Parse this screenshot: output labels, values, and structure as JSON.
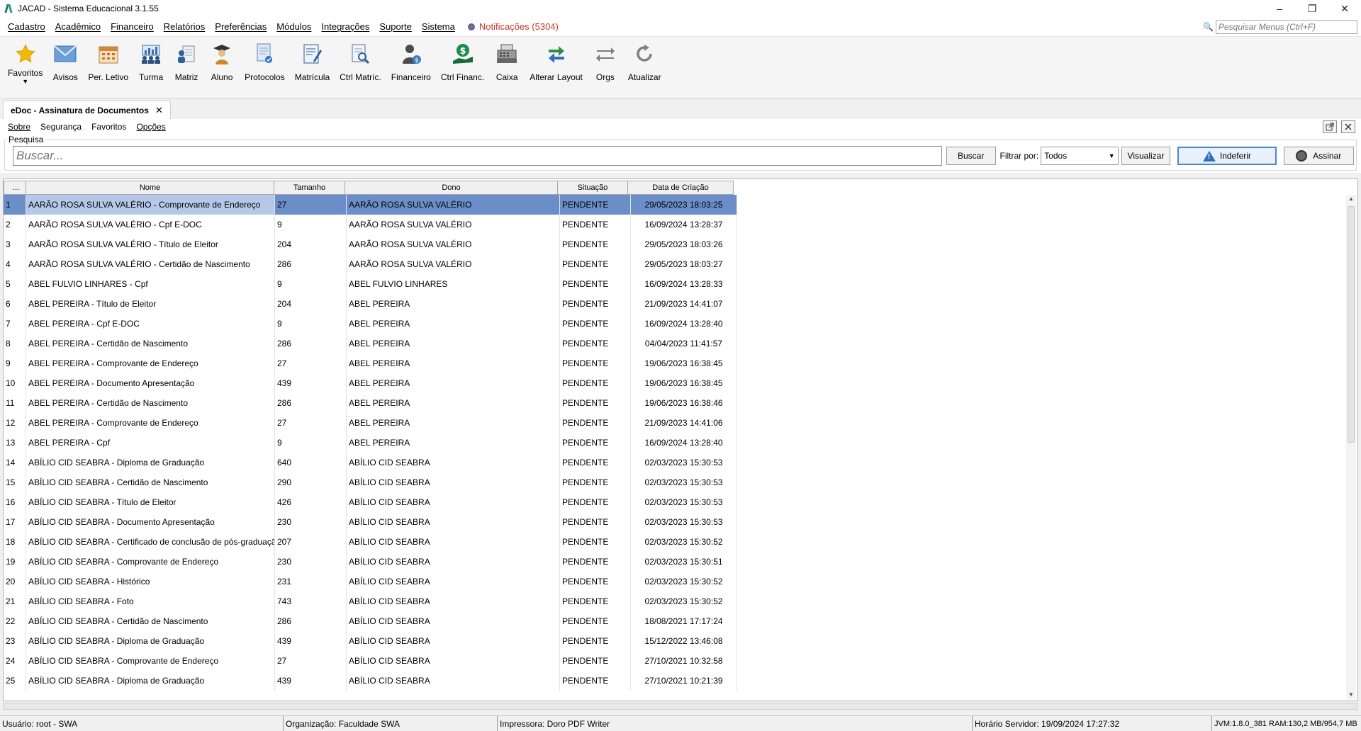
{
  "window": {
    "title": "JACAD - Sistema Educacional 3.1.55",
    "minimize": "–",
    "maximize": "❐",
    "close": "✕"
  },
  "menubar": {
    "items": [
      "Cadastro",
      "Acadêmico",
      "Financeiro",
      "Relatórios",
      "Preferências",
      "Módulos",
      "Integrações",
      "Suporte",
      "Sistema"
    ],
    "notifications": "Notificações (5304)",
    "search_placeholder": "Pesquisar Menus (Ctrl+F)"
  },
  "toolbar": {
    "favorites": "Favoritos",
    "tools": [
      {
        "label": "Avisos",
        "icon": "envelope-icon"
      },
      {
        "label": "Per. Letivo",
        "icon": "calendar-icon"
      },
      {
        "label": "Turma",
        "icon": "group-chart-icon"
      },
      {
        "label": "Matriz",
        "icon": "matrix-person-icon"
      },
      {
        "label": "Aluno",
        "icon": "graduate-icon"
      },
      {
        "label": "Protocolos",
        "icon": "protocol-doc-icon"
      },
      {
        "label": "Matrícula",
        "icon": "enrollment-doc-icon"
      },
      {
        "label": "Ctrl Matríc.",
        "icon": "doc-search-icon"
      },
      {
        "label": "Financeiro",
        "icon": "finance-person-icon"
      },
      {
        "label": "Ctrl Financ.",
        "icon": "money-hand-icon"
      },
      {
        "label": "Caixa",
        "icon": "cash-register-icon"
      },
      {
        "label": "Alterar Layout",
        "icon": "layout-switch-icon"
      },
      {
        "label": "Orgs",
        "icon": "swap-arrows-icon"
      },
      {
        "label": "Atualizar",
        "icon": "refresh-icon"
      }
    ]
  },
  "doc_tab": {
    "title": "eDoc - Assinatura de Documentos",
    "close": "✕"
  },
  "submenu": {
    "items": [
      "Sobre",
      "Segurança",
      "Favoritos",
      "Opções"
    ]
  },
  "search_panel": {
    "legend": "Pesquisa",
    "placeholder": "Buscar...",
    "buscar": "Buscar",
    "filter_label": "Filtrar por:",
    "filter_value": "Todos",
    "visualizar": "Visualizar",
    "indeferir": "Indeferir",
    "assinar": "Assinar"
  },
  "table": {
    "columns": [
      "...",
      "Nome",
      "Tamanho",
      "Dono",
      "Situação",
      "Data de Criação"
    ],
    "selected_row": 0,
    "rows": [
      [
        "1",
        "AARÃO ROSA SULVA VALÉRIO - Comprovante de Endereço",
        "27",
        "AARÃO ROSA SULVA VALÉRIO",
        "PENDENTE",
        "29/05/2023 18:03:25"
      ],
      [
        "2",
        "AARÃO ROSA SULVA VALÉRIO - Cpf E-DOC",
        "9",
        "AARÃO ROSA SULVA VALÉRIO",
        "PENDENTE",
        "16/09/2024 13:28:37"
      ],
      [
        "3",
        "AARÃO ROSA SULVA VALÉRIO - Título de Eleitor",
        "204",
        "AARÃO ROSA SULVA VALÉRIO",
        "PENDENTE",
        "29/05/2023 18:03:26"
      ],
      [
        "4",
        "AARÃO ROSA SULVA VALÉRIO - Certidão de Nascimento",
        "286",
        "AARÃO ROSA SULVA VALÉRIO",
        "PENDENTE",
        "29/05/2023 18:03:27"
      ],
      [
        "5",
        "ABEL FULVIO LINHARES - Cpf",
        "9",
        "ABEL FULVIO LINHARES",
        "PENDENTE",
        "16/09/2024 13:28:33"
      ],
      [
        "6",
        "ABEL PEREIRA - Título de Eleitor",
        "204",
        "ABEL PEREIRA",
        "PENDENTE",
        "21/09/2023 14:41:07"
      ],
      [
        "7",
        "ABEL PEREIRA - Cpf E-DOC",
        "9",
        "ABEL PEREIRA",
        "PENDENTE",
        "16/09/2024 13:28:40"
      ],
      [
        "8",
        "ABEL PEREIRA - Certidão de Nascimento",
        "286",
        "ABEL PEREIRA",
        "PENDENTE",
        "04/04/2023 11:41:57"
      ],
      [
        "9",
        "ABEL PEREIRA - Comprovante de Endereço",
        "27",
        "ABEL PEREIRA",
        "PENDENTE",
        "19/06/2023 16:38:45"
      ],
      [
        "10",
        "ABEL PEREIRA - Documento Apresentação",
        "439",
        "ABEL PEREIRA",
        "PENDENTE",
        "19/06/2023 16:38:45"
      ],
      [
        "11",
        "ABEL PEREIRA - Certidão de Nascimento",
        "286",
        "ABEL PEREIRA",
        "PENDENTE",
        "19/06/2023 16:38:46"
      ],
      [
        "12",
        "ABEL PEREIRA - Comprovante de Endereço",
        "27",
        "ABEL PEREIRA",
        "PENDENTE",
        "21/09/2023 14:41:06"
      ],
      [
        "13",
        "ABEL PEREIRA - Cpf",
        "9",
        "ABEL PEREIRA",
        "PENDENTE",
        "16/09/2024 13:28:40"
      ],
      [
        "14",
        "ABÍLIO CID SEABRA - Diploma de Graduação",
        "640",
        "ABÍLIO CID SEABRA",
        "PENDENTE",
        "02/03/2023 15:30:53"
      ],
      [
        "15",
        "ABÍLIO CID SEABRA - Certidão de Nascimento",
        "290",
        "ABÍLIO CID SEABRA",
        "PENDENTE",
        "02/03/2023 15:30:53"
      ],
      [
        "16",
        "ABÍLIO CID SEABRA - Título de Eleitor",
        "426",
        "ABÍLIO CID SEABRA",
        "PENDENTE",
        "02/03/2023 15:30:53"
      ],
      [
        "17",
        "ABÍLIO CID SEABRA - Documento Apresentação",
        "230",
        "ABÍLIO CID SEABRA",
        "PENDENTE",
        "02/03/2023 15:30:53"
      ],
      [
        "18",
        "ABÍLIO CID SEABRA - Certificado de conclusão de pós-graduação",
        "207",
        "ABÍLIO CID SEABRA",
        "PENDENTE",
        "02/03/2023 15:30:52"
      ],
      [
        "19",
        "ABÍLIO CID SEABRA - Comprovante de Endereço",
        "230",
        "ABÍLIO CID SEABRA",
        "PENDENTE",
        "02/03/2023 15:30:51"
      ],
      [
        "20",
        "ABÍLIO CID SEABRA - Histórico",
        "231",
        "ABÍLIO CID SEABRA",
        "PENDENTE",
        "02/03/2023 15:30:52"
      ],
      [
        "21",
        "ABÍLIO CID SEABRA - Foto",
        "743",
        "ABÍLIO CID SEABRA",
        "PENDENTE",
        "02/03/2023 15:30:52"
      ],
      [
        "22",
        "ABÍLIO CID SEABRA - Certidão de Nascimento",
        "286",
        "ABÍLIO CID SEABRA",
        "PENDENTE",
        "18/08/2021 17:17:24"
      ],
      [
        "23",
        "ABÍLIO CID SEABRA - Diploma de Graduação",
        "439",
        "ABÍLIO CID SEABRA",
        "PENDENTE",
        "15/12/2022 13:46:08"
      ],
      [
        "24",
        "ABÍLIO CID SEABRA - Comprovante de Endereço",
        "27",
        "ABÍLIO CID SEABRA",
        "PENDENTE",
        "27/10/2021 10:32:58"
      ],
      [
        "25",
        "ABÍLIO CID SEABRA - Diploma de Graduação",
        "439",
        "ABÍLIO CID SEABRA",
        "PENDENTE",
        "27/10/2021 10:21:39"
      ]
    ]
  },
  "statusbar": {
    "user": "Usuário: root - SWA",
    "org": "Organização: Faculdade SWA",
    "printer": "Impressora: Doro PDF Writer",
    "server_time": "Horário Servidor: 19/09/2024 17:27:32",
    "jvm": "JVM:1.8.0_381  RAM:130,2 MB/954,7 MB"
  },
  "colors": {
    "selection": "#6b8ec9",
    "notification": "#c0392b",
    "accent": "#4b86d1"
  }
}
